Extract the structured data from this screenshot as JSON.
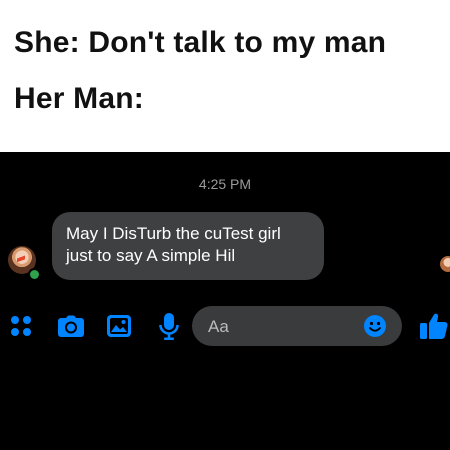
{
  "caption": {
    "line1": "She: Don't talk to my man",
    "line2": "Her Man:"
  },
  "chat": {
    "timestamp": "4:25 PM",
    "message": {
      "line1": "May I DisTurb the cuTest girl",
      "line2": "just to say A simple Hil"
    },
    "contact_online": true
  },
  "composer": {
    "placeholder": "Aa",
    "icons": [
      "apps-icon",
      "camera-icon",
      "image-icon",
      "microphone-icon",
      "emoji-icon",
      "like-thumbs-up-icon"
    ]
  },
  "colors": {
    "accent": "#0084ff",
    "background": "#000000",
    "bubble": "#3e4042",
    "input_background": "#3a3b3c",
    "online": "#31a24c"
  }
}
